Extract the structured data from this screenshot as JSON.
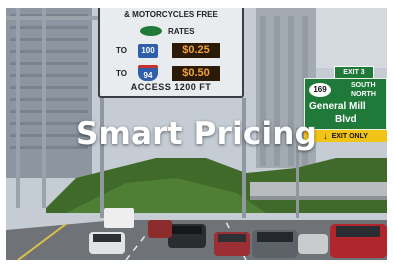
{
  "caption": "Smart Pricing",
  "toll_sign": {
    "header": "& MOTORCYCLES FREE",
    "rates_label": "RATES",
    "rows": [
      {
        "label": "TO",
        "route": "100",
        "price": "$0.25"
      },
      {
        "label": "TO",
        "route": "94",
        "price": "$0.50"
      }
    ],
    "footer": "ACCESS 1200 FT"
  },
  "exit_sign": {
    "exit_label": "EXIT 3",
    "route": "169",
    "direction_1": "SOUTH",
    "direction_2": "NORTH",
    "street_1": "General Mill",
    "street_2": "Blvd",
    "lane_label": "EXIT ONLY"
  },
  "colors": {
    "toll_sign_face": "#e9ecef",
    "rate_panel": "#d07a14",
    "exit_sign": "#1f7a3a",
    "lane_bar": "#f2c417"
  }
}
